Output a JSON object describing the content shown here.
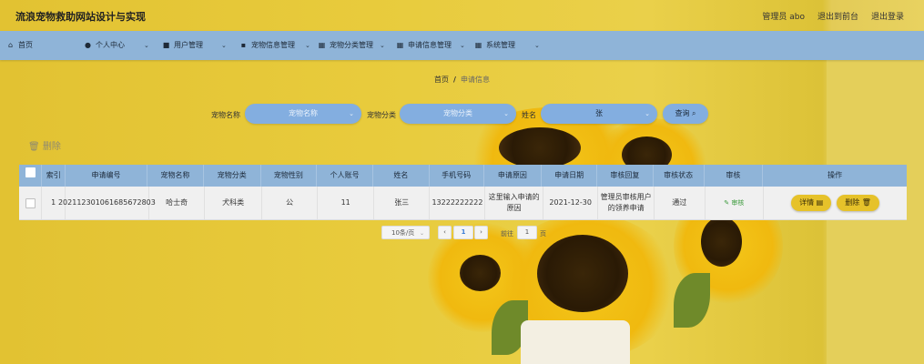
{
  "app": {
    "title": "流浪宠物救助网站设计与实现"
  },
  "top_links": {
    "admin": "管理员 abo",
    "to_front": "退出到前台",
    "logout": "退出登录"
  },
  "nav": [
    {
      "label": "首页",
      "icon": "home-icon"
    },
    {
      "label": "个人中心",
      "icon": "user-icon"
    },
    {
      "label": "用户管理",
      "icon": "briefcase-icon"
    },
    {
      "label": "宠物信息管理",
      "icon": "clipboard-icon"
    },
    {
      "label": "宠物分类管理",
      "icon": "grid-icon"
    },
    {
      "label": "申请信息管理",
      "icon": "grid-icon"
    },
    {
      "label": "系统管理",
      "icon": "grid-icon"
    }
  ],
  "breadcrumb": {
    "home": "首页",
    "separator": "/",
    "current": "申请信息"
  },
  "search": {
    "name_label": "宠物名称",
    "name_placeholder": "宠物名称",
    "name_value": "",
    "category_label": "宠物分类",
    "category_placeholder": "宠物分类",
    "category_value": "",
    "surname_label": "姓名",
    "surname_value": "张",
    "query_button": "查询"
  },
  "actions": {
    "delete": "删除"
  },
  "table": {
    "headers": [
      "索引",
      "申请编号",
      "宠物名称",
      "宠物分类",
      "宠物性别",
      "个人账号",
      "姓名",
      "手机号码",
      "申请原因",
      "申请日期",
      "审核回复",
      "审核状态",
      "审核",
      "操作"
    ],
    "rows": [
      {
        "index": "1",
        "code": "202112301061685672803",
        "pet_name": "哈士奇",
        "category": "犬科类",
        "gender": "公",
        "account": "11",
        "name": "张三",
        "phone": "13222222222",
        "reason": "这里输入申请的原因",
        "date": "2021-12-30",
        "reply": "管理员审核用户的领养申请",
        "status": "通过",
        "audit": "审核",
        "detail_btn": "详情",
        "delete_btn": "删除"
      }
    ]
  },
  "pagination": {
    "page_size": "10条/页",
    "current_page": "1",
    "goto_label": "前往",
    "goto_value": "1",
    "page_suffix": "页"
  },
  "colors": {
    "nav": "#8fb4d8",
    "button": "#83aee0",
    "accent": "#e6c22a",
    "background": "#e6c93a"
  }
}
